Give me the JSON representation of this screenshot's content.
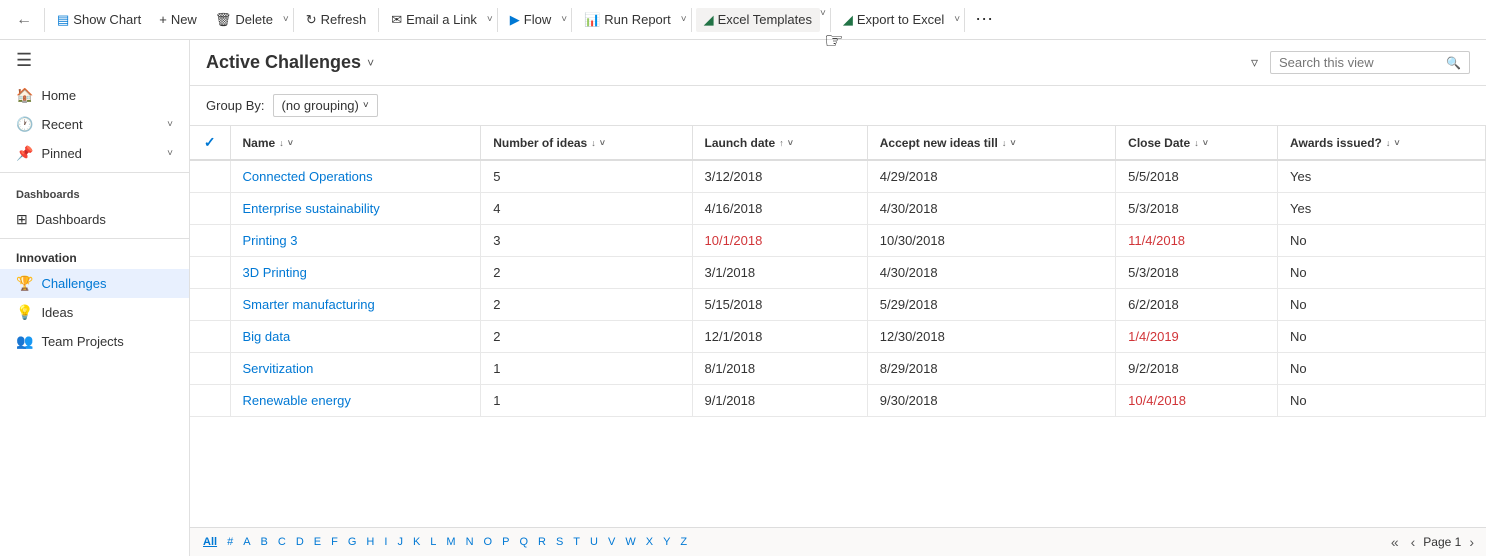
{
  "toolbar": {
    "back_label": "←",
    "show_chart_label": "Show Chart",
    "new_label": "New",
    "delete_label": "Delete",
    "refresh_label": "Refresh",
    "email_link_label": "Email a Link",
    "flow_label": "Flow",
    "run_report_label": "Run Report",
    "excel_templates_label": "Excel Templates",
    "export_excel_label": "Export to Excel",
    "more_label": "⋯"
  },
  "header": {
    "view_title": "Active Challenges",
    "search_placeholder": "Search this view",
    "filter_icon": "filter-icon"
  },
  "groupby": {
    "label": "Group By:",
    "value": "(no grouping)"
  },
  "table": {
    "columns": [
      {
        "id": "checkbox",
        "label": "✓",
        "sort": ""
      },
      {
        "id": "name",
        "label": "Name",
        "sort": "↓"
      },
      {
        "id": "number_of_ideas",
        "label": "Number of ideas",
        "sort": "↓"
      },
      {
        "id": "launch_date",
        "label": "Launch date",
        "sort": "↑"
      },
      {
        "id": "accept_new_ideas_till",
        "label": "Accept new ideas till",
        "sort": "↓"
      },
      {
        "id": "close_date",
        "label": "Close Date",
        "sort": "↓"
      },
      {
        "id": "awards_issued",
        "label": "Awards issued?",
        "sort": "↓"
      }
    ],
    "rows": [
      {
        "name": "Connected Operations",
        "number_of_ideas": "5",
        "launch_date": "3/12/2018",
        "launch_date_red": false,
        "accept_till": "4/29/2018",
        "accept_till_red": false,
        "close_date": "5/5/2018",
        "close_date_red": false,
        "awards_issued": "Yes"
      },
      {
        "name": "Enterprise sustainability",
        "number_of_ideas": "4",
        "launch_date": "4/16/2018",
        "launch_date_red": false,
        "accept_till": "4/30/2018",
        "accept_till_red": false,
        "close_date": "5/3/2018",
        "close_date_red": false,
        "awards_issued": "Yes"
      },
      {
        "name": "Printing 3",
        "number_of_ideas": "3",
        "launch_date": "10/1/2018",
        "launch_date_red": true,
        "accept_till": "10/30/2018",
        "accept_till_red": false,
        "close_date": "11/4/2018",
        "close_date_red": true,
        "awards_issued": "No"
      },
      {
        "name": "3D Printing",
        "number_of_ideas": "2",
        "launch_date": "3/1/2018",
        "launch_date_red": false,
        "accept_till": "4/30/2018",
        "accept_till_red": false,
        "close_date": "5/3/2018",
        "close_date_red": false,
        "awards_issued": "No"
      },
      {
        "name": "Smarter manufacturing",
        "number_of_ideas": "2",
        "launch_date": "5/15/2018",
        "launch_date_red": false,
        "accept_till": "5/29/2018",
        "accept_till_red": false,
        "close_date": "6/2/2018",
        "close_date_red": false,
        "awards_issued": "No"
      },
      {
        "name": "Big data",
        "number_of_ideas": "2",
        "launch_date": "12/1/2018",
        "launch_date_red": false,
        "accept_till": "12/30/2018",
        "accept_till_red": false,
        "close_date": "1/4/2019",
        "close_date_red": true,
        "awards_issued": "No"
      },
      {
        "name": "Servitization",
        "number_of_ideas": "1",
        "launch_date": "8/1/2018",
        "launch_date_red": false,
        "accept_till": "8/29/2018",
        "accept_till_red": false,
        "close_date": "9/2/2018",
        "close_date_red": false,
        "awards_issued": "No"
      },
      {
        "name": "Renewable energy",
        "number_of_ideas": "1",
        "launch_date": "9/1/2018",
        "launch_date_red": false,
        "accept_till": "9/30/2018",
        "accept_till_red": false,
        "close_date": "10/4/2018",
        "close_date_red": true,
        "awards_issued": "No"
      }
    ]
  },
  "sidebar": {
    "sections": [
      {
        "header": "",
        "items": [
          {
            "id": "home",
            "label": "Home",
            "icon": "🏠",
            "has_chevron": false
          },
          {
            "id": "recent",
            "label": "Recent",
            "icon": "🕐",
            "has_chevron": true
          },
          {
            "id": "pinned",
            "label": "Pinned",
            "icon": "📌",
            "has_chevron": true
          }
        ]
      },
      {
        "header": "Dashboards",
        "items": [
          {
            "id": "dashboards",
            "label": "Dashboards",
            "icon": "⊞",
            "has_chevron": false
          }
        ]
      },
      {
        "header": "Innovation",
        "items": [
          {
            "id": "challenges",
            "label": "Challenges",
            "icon": "🏆",
            "has_chevron": false,
            "active": true
          },
          {
            "id": "ideas",
            "label": "Ideas",
            "icon": "💡",
            "has_chevron": false
          },
          {
            "id": "team-projects",
            "label": "Team Projects",
            "icon": "👥",
            "has_chevron": false
          }
        ]
      }
    ]
  },
  "pagination": {
    "alpha": [
      "All",
      "#",
      "A",
      "B",
      "C",
      "D",
      "E",
      "F",
      "G",
      "H",
      "I",
      "J",
      "K",
      "L",
      "M",
      "N",
      "O",
      "P",
      "Q",
      "R",
      "S",
      "T",
      "U",
      "V",
      "W",
      "X",
      "Y",
      "Z"
    ],
    "active_alpha": "All",
    "page_text": "Page 1",
    "prev_label": "‹",
    "next_label": "›",
    "first_label": "«",
    "last_label": "»"
  },
  "colors": {
    "accent": "#0078d4",
    "red": "#d13438",
    "border": "#e0e0e0",
    "header_bg": "#fff",
    "sidebar_active_bg": "#e8f0fe"
  }
}
